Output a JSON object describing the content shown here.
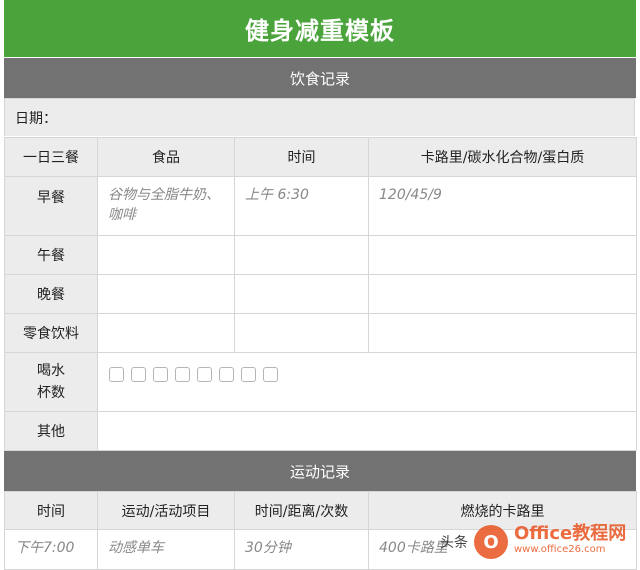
{
  "title": "健身减重模板",
  "diet": {
    "section_title": "饮食记录",
    "date_label": "日期：",
    "headers": [
      "一日三餐",
      "食品",
      "时间",
      "卡路里/碳水化合物/蛋白质"
    ],
    "rows": [
      {
        "meal": "早餐",
        "food": "谷物与全脂牛奶、咖啡",
        "time": "上午 6:30",
        "nutrition": "120/45/9"
      },
      {
        "meal": "午餐",
        "food": "",
        "time": "",
        "nutrition": ""
      },
      {
        "meal": "晚餐",
        "food": "",
        "time": "",
        "nutrition": ""
      },
      {
        "meal": "零食饮料",
        "food": "",
        "time": "",
        "nutrition": ""
      }
    ],
    "water_label": "喝水\n杯数",
    "water_cups": 8,
    "other_label": "其他"
  },
  "exercise": {
    "section_title": "运动记录",
    "headers": [
      "时间",
      "运动/活动项目",
      "时间/距离/次数",
      "燃烧的卡路里"
    ],
    "rows": [
      {
        "time": "下午7:00",
        "activity": "动感单车",
        "amount": "30分钟",
        "calories": "400卡路里"
      }
    ]
  },
  "watermark": {
    "prefix": "头条",
    "brand": "Office教程网",
    "url": "www.office26.com"
  }
}
